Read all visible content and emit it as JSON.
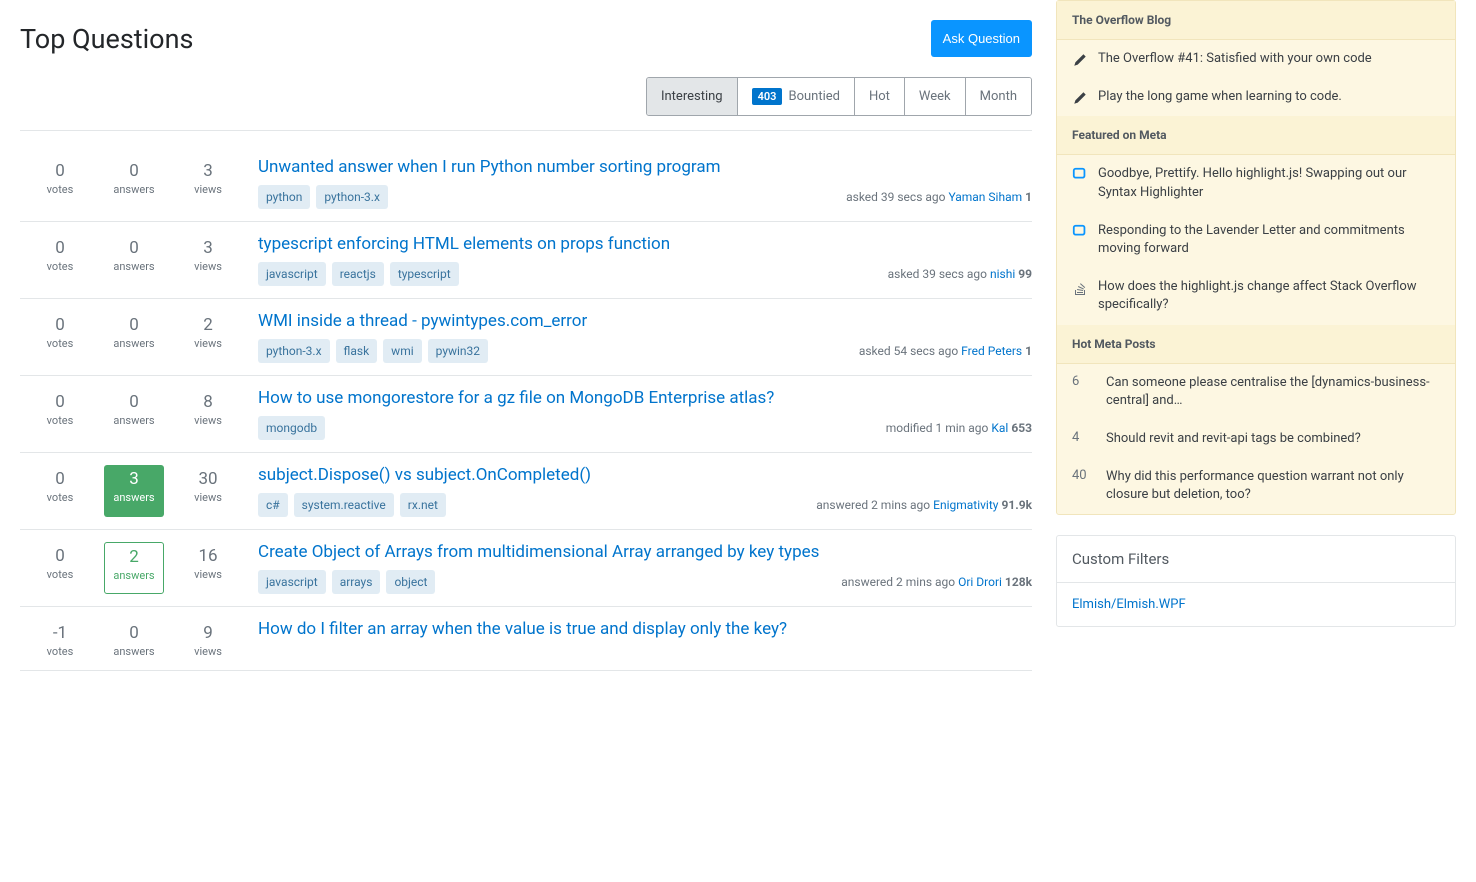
{
  "header": {
    "title": "Top Questions",
    "ask": "Ask Question"
  },
  "tabs": [
    {
      "label": "Interesting",
      "active": true
    },
    {
      "label": "Bountied",
      "badge": "403"
    },
    {
      "label": "Hot"
    },
    {
      "label": "Week"
    },
    {
      "label": "Month"
    }
  ],
  "questions": [
    {
      "votes": 0,
      "answers": 0,
      "views": 3,
      "title": "Unwanted answer when I run Python number sorting program",
      "tags": [
        "python",
        "python-3.x"
      ],
      "action": "asked",
      "time": "39 secs ago",
      "user": "Yaman Siham",
      "rep": "1",
      "answer_state": "none"
    },
    {
      "votes": 0,
      "answers": 0,
      "views": 3,
      "title": "typescript enforcing HTML elements on props function",
      "tags": [
        "javascript",
        "reactjs",
        "typescript"
      ],
      "action": "asked",
      "time": "39 secs ago",
      "user": "nishi",
      "rep": "99",
      "answer_state": "none"
    },
    {
      "votes": 0,
      "answers": 0,
      "views": 2,
      "title": "WMI inside a thread - pywintypes.com_error",
      "tags": [
        "python-3.x",
        "flask",
        "wmi",
        "pywin32"
      ],
      "action": "asked",
      "time": "54 secs ago",
      "user": "Fred Peters",
      "rep": "1",
      "answer_state": "none"
    },
    {
      "votes": 0,
      "answers": 0,
      "views": 8,
      "title": "How to use mongorestore for a gz file on MongoDB Enterprise atlas?",
      "tags": [
        "mongodb"
      ],
      "action": "modified",
      "time": "1 min ago",
      "user": "Kal",
      "rep": "653",
      "answer_state": "none"
    },
    {
      "votes": 0,
      "answers": 3,
      "views": 30,
      "title": "subject.Dispose() vs subject.OnCompleted()",
      "tags": [
        "c#",
        "system.reactive",
        "rx.net"
      ],
      "action": "answered",
      "time": "2 mins ago",
      "user": "Enigmativity",
      "rep": "91.9k",
      "answer_state": "accepted"
    },
    {
      "votes": 0,
      "answers": 2,
      "views": 16,
      "title": "Create Object of Arrays from multidimensional Array arranged by key types",
      "tags": [
        "javascript",
        "arrays",
        "object"
      ],
      "action": "answered",
      "time": "2 mins ago",
      "user": "Ori Drori",
      "rep": "128k",
      "answer_state": "has-answers"
    },
    {
      "votes": -1,
      "answers": 0,
      "views": 9,
      "title": "How do I filter an array when the value is true and display only the key?",
      "tags": [],
      "action": "",
      "time": "",
      "user": "",
      "rep": "",
      "answer_state": "none"
    }
  ],
  "stat_labels": {
    "votes": "votes",
    "answers": "answers",
    "views": "views"
  },
  "sidebar_blog": {
    "header": "The Overflow Blog",
    "items": [
      "The Overflow #41: Satisfied with your own code",
      "Play the long game when learning to code."
    ]
  },
  "sidebar_meta": {
    "header": "Featured on Meta",
    "items": [
      {
        "icon": "chat",
        "text": "Goodbye, Prettify. Hello highlight.js! Swapping out our Syntax Highlighter"
      },
      {
        "icon": "chat",
        "text": "Responding to the Lavender Letter and commitments moving forward"
      },
      {
        "icon": "so",
        "text": "How does the highlight.js change affect Stack Overflow specifically?"
      }
    ]
  },
  "sidebar_hot": {
    "header": "Hot Meta Posts",
    "items": [
      {
        "score": "6",
        "text": "Can someone please centralise the [dynamics-business-central] and…"
      },
      {
        "score": "4",
        "text": "Should revit and revit-api tags be combined?"
      },
      {
        "score": "40",
        "text": "Why did this performance question warrant not only closure but deletion, too?"
      }
    ]
  },
  "custom_filters": {
    "header": "Custom Filters",
    "items": [
      "Elmish/Elmish.WPF"
    ]
  }
}
